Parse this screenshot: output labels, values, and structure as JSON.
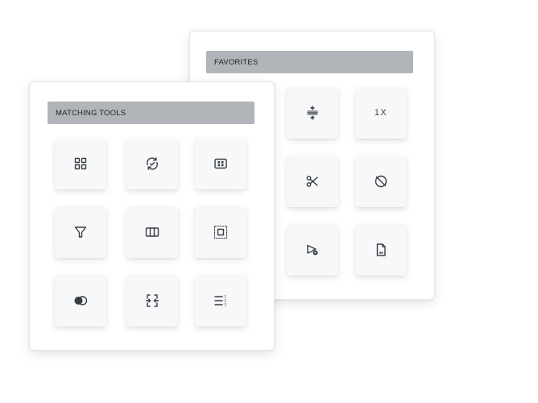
{
  "favorites": {
    "title": "FAVORITES",
    "tiles": [
      {
        "icon": "compress-vertical-icon"
      },
      {
        "icon": "zoom-1x-icon",
        "label": "1X"
      },
      {
        "icon": "scissors-icon"
      },
      {
        "icon": "disabled-circle-icon"
      },
      {
        "icon": "send-play-icon"
      },
      {
        "icon": "image-file-icon"
      }
    ]
  },
  "matching_tools": {
    "title": "MATCHING TOOLS",
    "tiles": [
      {
        "icon": "grid-view-icon"
      },
      {
        "icon": "sync-check-icon"
      },
      {
        "icon": "dashboard-box-icon"
      },
      {
        "icon": "filter-icon"
      },
      {
        "icon": "columns-icon"
      },
      {
        "icon": "select-area-icon"
      },
      {
        "icon": "blend-circles-icon"
      },
      {
        "icon": "compress-horizontal-icon"
      },
      {
        "icon": "numbered-list-icon"
      }
    ]
  },
  "colors": {
    "header_bg": "#b1b5b9",
    "tile_bg": "#f7f8f9",
    "icon": "#3a3e42"
  }
}
